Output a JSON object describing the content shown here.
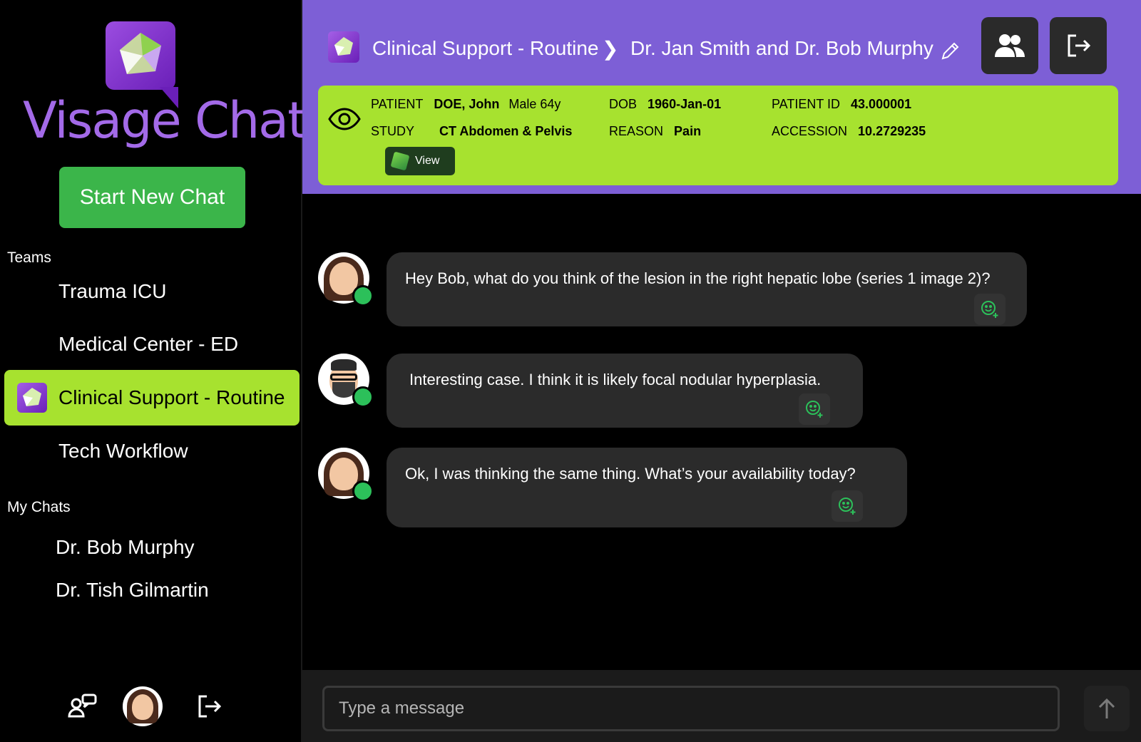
{
  "brand": {
    "word1": "Visage",
    "word2": "Chat",
    "trademark": "®"
  },
  "sidebar": {
    "new_chat_label": "Start New Chat",
    "teams_label": "Teams",
    "teams": [
      {
        "label": "Trauma ICU"
      },
      {
        "label": "Medical Center - ED"
      },
      {
        "label": "Clinical Support - Routine",
        "active": true
      },
      {
        "label": "Tech Workflow"
      }
    ],
    "my_chats_label": "My Chats",
    "chats": [
      {
        "label": "Dr. Bob Murphy"
      },
      {
        "label": "Dr. Tish Gilmartin"
      }
    ]
  },
  "header": {
    "team": "Clinical Support - Routine",
    "separator": "❯",
    "conversation": "Dr. Jan Smith and Dr. Bob Murphy"
  },
  "patient": {
    "patient_label": "PATIENT",
    "patient_name": "DOE, John",
    "patient_sex_age": "Male 64y",
    "study_label": "STUDY",
    "study": "CT Abdomen & Pelvis",
    "dob_label": "DOB",
    "dob": "1960-Jan-01",
    "reason_label": "REASON",
    "reason": "Pain",
    "patient_id_label": "PATIENT ID",
    "patient_id": "43.000001",
    "accession_label": "ACCESSION",
    "accession": "10.2729235",
    "view_label": "View"
  },
  "messages": [
    {
      "sender": "jan",
      "text": "Hey Bob, what do you think of the lesion in the right hepatic lobe (series 1 image 2)?"
    },
    {
      "sender": "bob",
      "text": "Interesting case. I think it is likely focal nodular hyperplasia."
    },
    {
      "sender": "jan",
      "text": "Ok, I was thinking the same thing. What’s your availability today?"
    }
  ],
  "composer": {
    "placeholder": "Type a message"
  },
  "colors": {
    "accent_green": "#a7e22f",
    "button_green": "#3bb54a",
    "header_purple": "#7d5fd6",
    "brand_purple": "#a36ae8",
    "online": "#2cc05a"
  },
  "icons": [
    "eye-icon",
    "pencil-icon",
    "participants-icon",
    "exit-icon",
    "send-arrow-icon",
    "add-reaction-icon",
    "chat-people-icon",
    "logout-icon"
  ]
}
